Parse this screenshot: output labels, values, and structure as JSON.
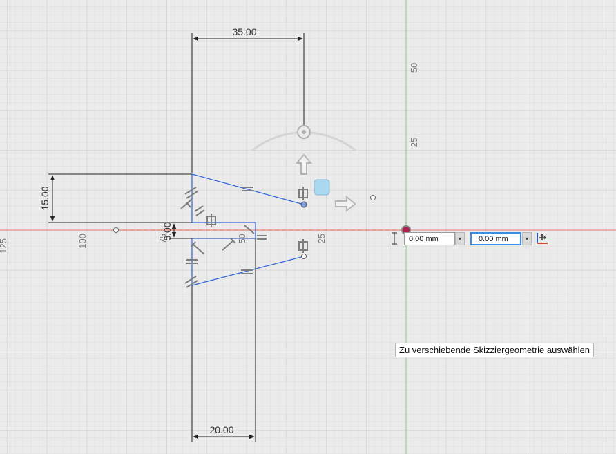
{
  "sketch": {
    "dimensions": {
      "top_width": "35.00",
      "bottom_width": "20.00",
      "left_height": "15.00",
      "small_offset": "5.00"
    },
    "ruler": {
      "horizontal_labels": [
        "125",
        "100",
        "75",
        "50",
        "25"
      ],
      "vertical_labels": [
        "50",
        "25"
      ]
    }
  },
  "move_tool": {
    "x_value": "0.00 mm",
    "y_value": "0.00 mm",
    "dropdown_glyph": "▾"
  },
  "tooltip": {
    "text": "Zu verschiebende Skizziergeometrie auswählen"
  },
  "colors": {
    "background": "#ebebeb",
    "grid_minor": "#dcdcdc",
    "grid_major": "#cfcfcf",
    "x_axis": "#e0766c",
    "y_axis": "#7fd07f",
    "profile": "#2f64d8",
    "dimension": "#222222",
    "selected_field_border": "#3a8ee6"
  }
}
